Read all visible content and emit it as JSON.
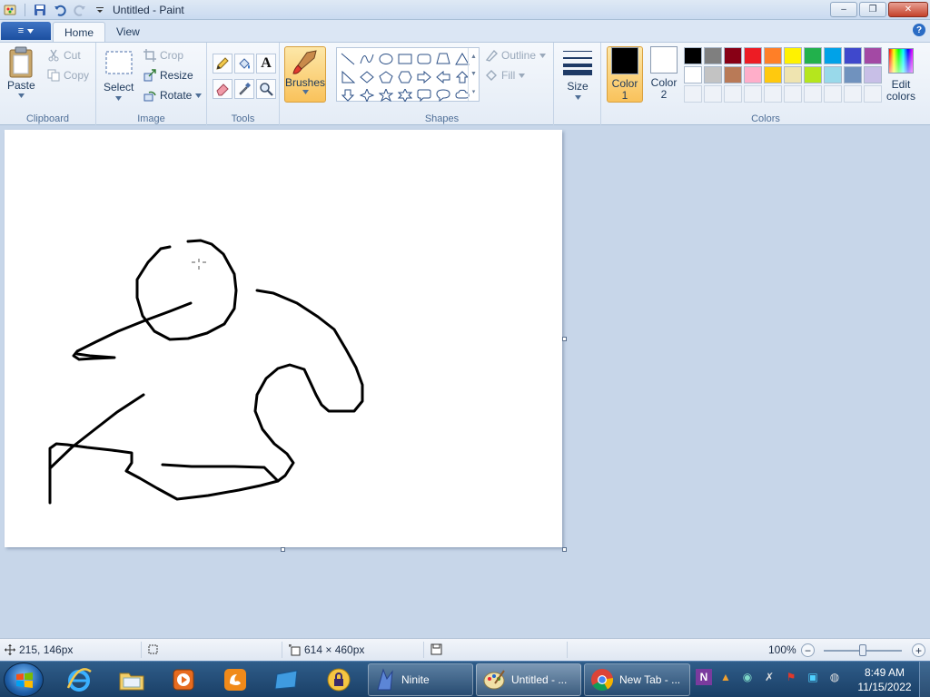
{
  "window": {
    "title": "Untitled - Paint",
    "controls": {
      "minimize": "–",
      "maximize": "❐",
      "close": "✕"
    }
  },
  "tabs": {
    "file_icon": "≡",
    "home": "Home",
    "view": "View",
    "help": "?"
  },
  "ribbon": {
    "clipboard": {
      "label": "Clipboard",
      "paste": "Paste",
      "cut": "Cut",
      "copy": "Copy"
    },
    "image": {
      "label": "Image",
      "select": "Select",
      "crop": "Crop",
      "resize": "Resize",
      "rotate": "Rotate"
    },
    "tools": {
      "label": "Tools",
      "text_glyph": "A"
    },
    "brushes": {
      "label": "Brushes"
    },
    "shapes": {
      "label": "Shapes",
      "outline": "Outline",
      "fill": "Fill"
    },
    "size": {
      "label": "Size"
    },
    "colors": {
      "label": "Colors",
      "color1": {
        "line1": "Color",
        "line2": "1",
        "value": "#000000"
      },
      "color2": {
        "line1": "Color",
        "line2": "2",
        "value": "#ffffff"
      },
      "edit": {
        "line1": "Edit",
        "line2": "colors"
      },
      "palette_row1": [
        "#000000",
        "#7f7f7f",
        "#880015",
        "#ed1c24",
        "#ff7f27",
        "#fff200",
        "#22b14c",
        "#00a2e8",
        "#3f48cc",
        "#a349a4"
      ],
      "palette_row2": [
        "#ffffff",
        "#c3c3c3",
        "#b97a57",
        "#ffaec9",
        "#ffc90e",
        "#efe4b0",
        "#b5e61d",
        "#99d9ea",
        "#7092be",
        "#c8bfe7"
      ]
    }
  },
  "canvas": {
    "background": "#ffffff",
    "stroke_color": "#000000"
  },
  "statusbar": {
    "cursor_position": "215, 146px",
    "canvas_size": "614 × 460px",
    "zoom": "100%",
    "zoom_level": 1.0
  },
  "taskbar": {
    "windows": [
      {
        "label": "Ninite",
        "icon": "ninite-icon"
      },
      {
        "label": "Untitled - ...",
        "icon": "paint-icon"
      },
      {
        "label": "New Tab - ...",
        "icon": "chrome-icon"
      }
    ],
    "clock": {
      "time": "8:49 AM",
      "date": "11/15/2022"
    }
  }
}
